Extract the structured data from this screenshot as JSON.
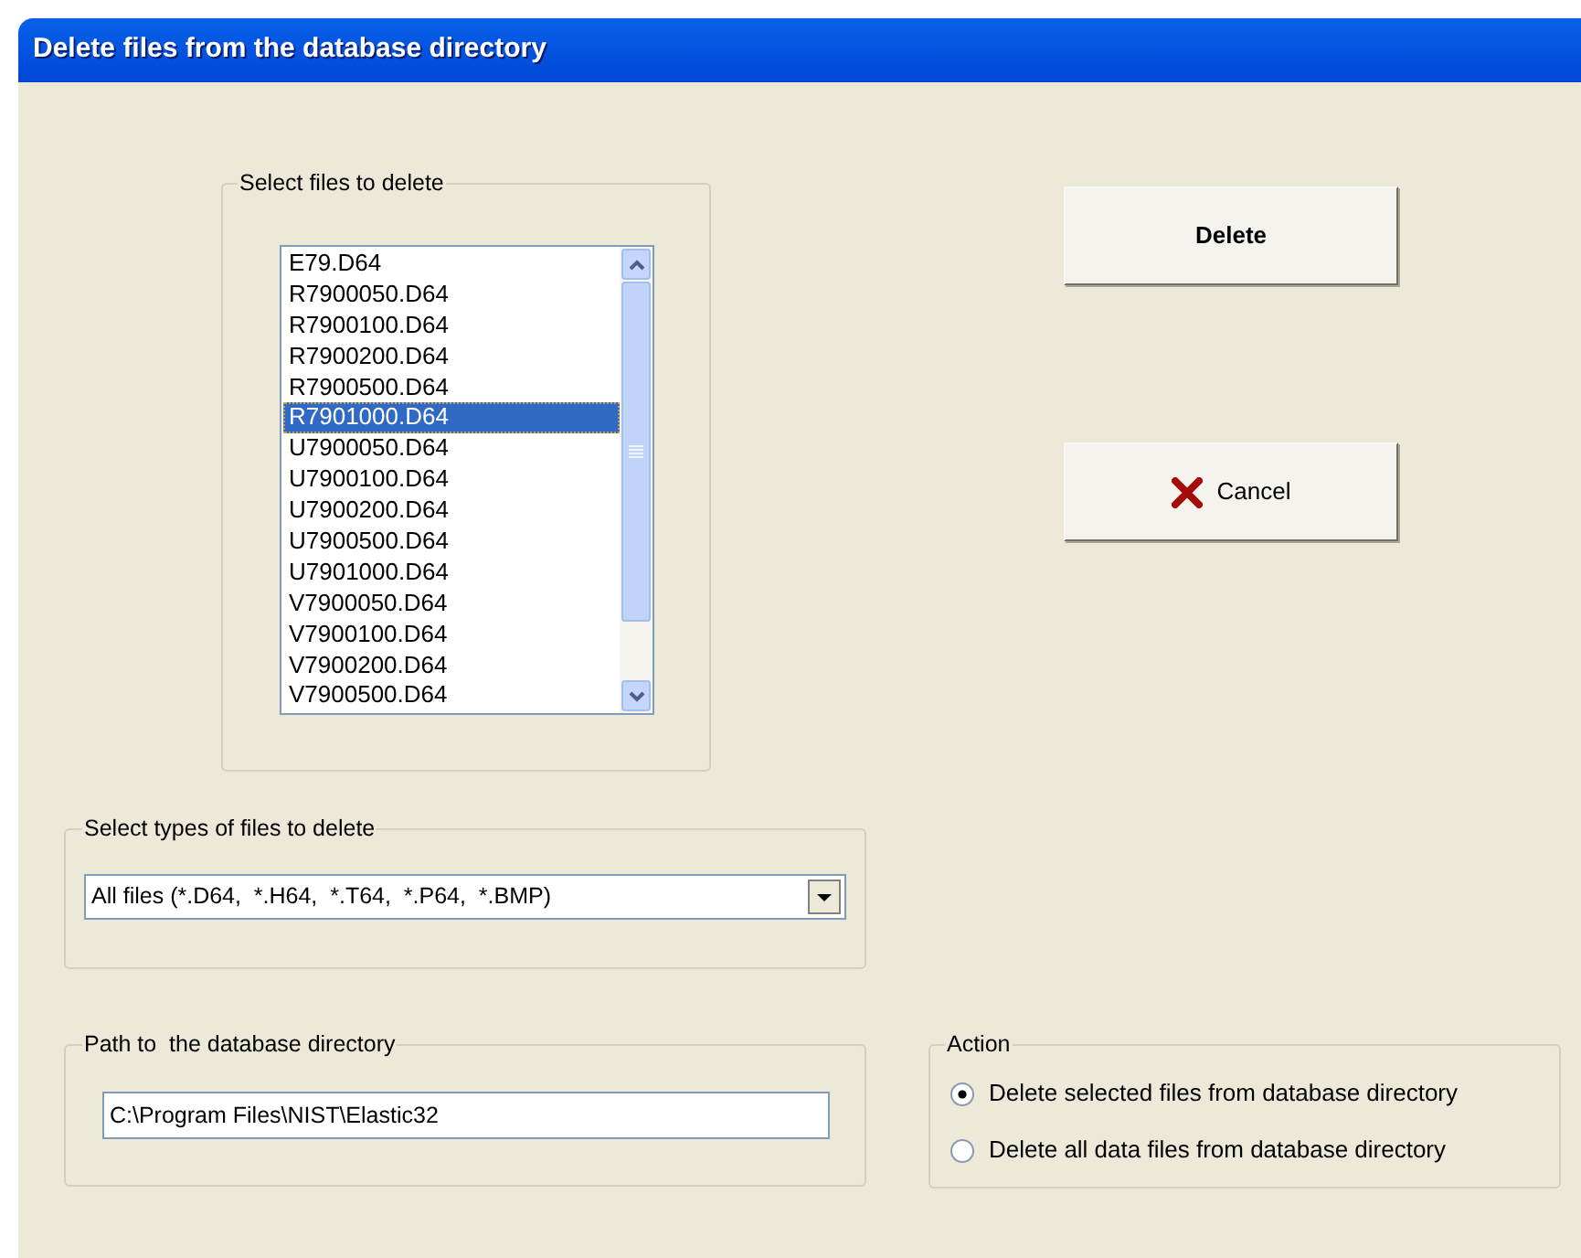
{
  "window": {
    "title": "Delete files from the database directory"
  },
  "files_group": {
    "label": "Select files to delete",
    "files": [
      {
        "name": "E79.D64",
        "selected": false
      },
      {
        "name": "R7900050.D64",
        "selected": false
      },
      {
        "name": "R7900100.D64",
        "selected": false
      },
      {
        "name": "R7900200.D64",
        "selected": false
      },
      {
        "name": "R7900500.D64",
        "selected": false
      },
      {
        "name": "R7901000.D64",
        "selected": true
      },
      {
        "name": "U7900050.D64",
        "selected": false
      },
      {
        "name": "U7900100.D64",
        "selected": false
      },
      {
        "name": "U7900200.D64",
        "selected": false
      },
      {
        "name": "U7900500.D64",
        "selected": false
      },
      {
        "name": "U7901000.D64",
        "selected": false
      },
      {
        "name": "V7900050.D64",
        "selected": false
      },
      {
        "name": "V7900100.D64",
        "selected": false
      },
      {
        "name": "V7900200.D64",
        "selected": false
      },
      {
        "name": "V7900500.D64",
        "selected": false
      }
    ]
  },
  "buttons": [
    {
      "label": "Delete",
      "kind": "primary"
    },
    {
      "label": "Cancel",
      "kind": "cancel"
    }
  ],
  "types_group": {
    "label": "Select types of files to delete",
    "value": "All files (*.D64,  *.H64,  *.T64,  *.P64,  *.BMP)"
  },
  "path_group": {
    "label": "Path to  the database directory",
    "value": "C:\\Program Files\\NIST\\Elastic32"
  },
  "action_group": {
    "label": "Action",
    "options": [
      {
        "label": "Delete selected files from database directory",
        "selected": true
      },
      {
        "label": "Delete all data files from database directory",
        "selected": false
      }
    ]
  }
}
